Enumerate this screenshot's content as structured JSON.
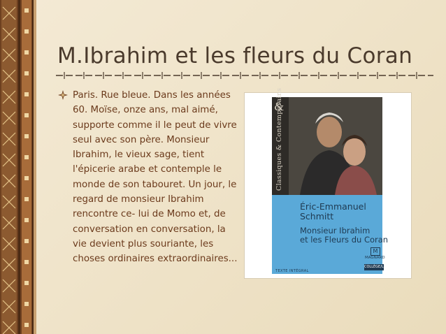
{
  "slide": {
    "title": "M.Ibrahim et les fleurs du Coran",
    "bullet_icon": "sparkle-bullet-icon",
    "paragraph": "Paris. Rue bleue. Dans les années 60. Moïse, onze ans, mal aimé, supporte comme il le peut de vivre  seul avec son père. Monsieur Ibrahim, le vieux sage, tient l'épicerie arabe et contemple le monde de son tabouret. Un jour, le regard de monsieur Ibrahim rencontre ce- lui de Momo et, de conversation en conversation, la vie devient plus souriante, les choses ordinaires extraordinaires..."
  },
  "book_cover": {
    "series_mark": "&",
    "series_name": "Classiques & Contemporains",
    "author_line1": "Éric-Emmanuel",
    "author_line2": "Schmitt",
    "title_line1": "Monsieur Ibrahim",
    "title_line2": "et les Fleurs du Coran",
    "edition": "TEXTE INTÉGRAL",
    "publisher_logo": "M",
    "publisher": "MAGNARD",
    "collection": "COLLÈGE/LP"
  },
  "colors": {
    "background": "#f0e6cf",
    "title": "#4a3a2c",
    "text": "#6b3a1c",
    "strip": "#7a4a26",
    "cover_blue": "#5aa9d8"
  }
}
